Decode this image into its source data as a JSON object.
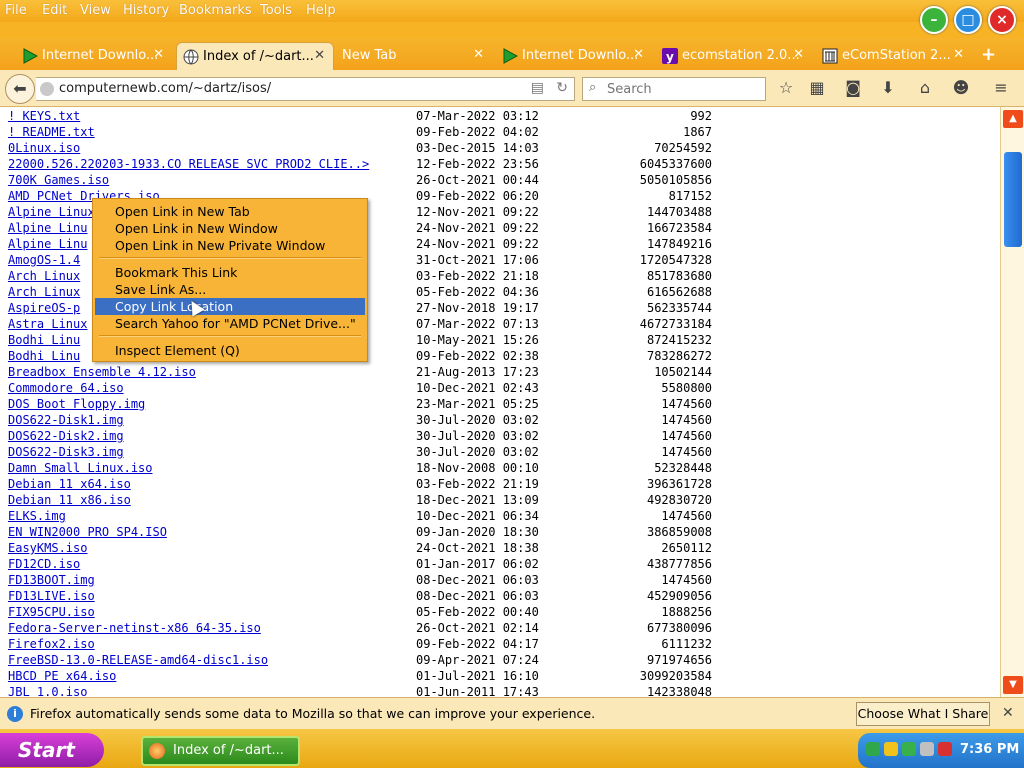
{
  "menus": [
    "File",
    "Edit",
    "View",
    "History",
    "Bookmarks",
    "Tools",
    "Help"
  ],
  "tabs": [
    {
      "label": "Internet Downlo...",
      "icon": "play-icon"
    },
    {
      "label": "Index of /~dart...",
      "icon": "globe-icon",
      "active": true
    },
    {
      "label": "New Tab",
      "icon": ""
    },
    {
      "label": "Internet Downlo...",
      "icon": "play-icon"
    },
    {
      "label": "ecomstation 2.0...",
      "icon": "yahoo-icon"
    },
    {
      "label": "eComStation 2...",
      "icon": "archive-icon"
    }
  ],
  "nav": {
    "url": "computernewb.com/~dartz/isos/",
    "search_placeholder": "Search"
  },
  "files": [
    {
      "name": "! KEYS.txt",
      "date": "07-Mar-2022 03:12",
      "size": "992"
    },
    {
      "name": "! README.txt",
      "date": "09-Feb-2022 04:02",
      "size": "1867"
    },
    {
      "name": "0Linux.iso",
      "date": "03-Dec-2015 14:03",
      "size": "70254592"
    },
    {
      "name": "22000.526.220203-1933.CO RELEASE SVC PROD2 CLIE..>",
      "date": "12-Feb-2022 23:56",
      "size": "6045337600"
    },
    {
      "name": "700K Games.iso",
      "date": "26-Oct-2021 00:44",
      "size": "5050105856"
    },
    {
      "name": "AMD PCNet Drivers.iso",
      "date": "09-Feb-2022 06:20",
      "size": "817152"
    },
    {
      "name": "Alpine Linux",
      "date": "12-Nov-2021 09:22",
      "size": "144703488"
    },
    {
      "name": "Alpine Linu",
      "date": "24-Nov-2021 09:22",
      "size": "166723584"
    },
    {
      "name": "Alpine Linu",
      "date": "24-Nov-2021 09:22",
      "size": "147849216"
    },
    {
      "name": "AmogOS-1.4",
      "date": "31-Oct-2021 17:06",
      "size": "1720547328"
    },
    {
      "name": "Arch Linux",
      "date": "03-Feb-2022 21:18",
      "size": "851783680"
    },
    {
      "name": "Arch Linux",
      "date": "05-Feb-2022 04:36",
      "size": "616562688"
    },
    {
      "name": "AspireOS-p",
      "date": "27-Nov-2018 19:17",
      "size": "562335744"
    },
    {
      "name": "Astra Linux",
      "date": "07-Mar-2022 07:13",
      "size": "4672733184"
    },
    {
      "name": "Bodhi Linu",
      "date": "10-May-2021 15:26",
      "size": "872415232"
    },
    {
      "name": "Bodhi Linu",
      "date": "09-Feb-2022 02:38",
      "size": "783286272"
    },
    {
      "name": "Breadbox Ensemble 4.12.iso",
      "date": "21-Aug-2013 17:23",
      "size": "10502144"
    },
    {
      "name": "Commodore 64.iso",
      "date": "10-Dec-2021 02:43",
      "size": "5580800"
    },
    {
      "name": "DOS Boot Floppy.img",
      "date": "23-Mar-2021 05:25",
      "size": "1474560"
    },
    {
      "name": "DOS622-Disk1.img",
      "date": "30-Jul-2020 03:02",
      "size": "1474560"
    },
    {
      "name": "DOS622-Disk2.img",
      "date": "30-Jul-2020 03:02",
      "size": "1474560"
    },
    {
      "name": "DOS622-Disk3.img",
      "date": "30-Jul-2020 03:02",
      "size": "1474560"
    },
    {
      "name": "Damn Small Linux.iso",
      "date": "18-Nov-2008 00:10",
      "size": "52328448"
    },
    {
      "name": "Debian 11 x64.iso",
      "date": "03-Feb-2022 21:19",
      "size": "396361728"
    },
    {
      "name": "Debian 11 x86.iso",
      "date": "18-Dec-2021 13:09",
      "size": "492830720"
    },
    {
      "name": "ELKS.img",
      "date": "10-Dec-2021 06:34",
      "size": "1474560"
    },
    {
      "name": "EN WIN2000 PRO SP4.ISO",
      "date": "09-Jan-2020 18:30",
      "size": "386859008"
    },
    {
      "name": "EasyKMS.iso",
      "date": "24-Oct-2021 18:38",
      "size": "2650112"
    },
    {
      "name": "FD12CD.iso",
      "date": "01-Jan-2017 06:02",
      "size": "438777856"
    },
    {
      "name": "FD13BOOT.img",
      "date": "08-Dec-2021 06:03",
      "size": "1474560"
    },
    {
      "name": "FD13LIVE.iso",
      "date": "08-Dec-2021 06:03",
      "size": "452909056"
    },
    {
      "name": "FIX95CPU.iso",
      "date": "05-Feb-2022 00:40",
      "size": "1888256"
    },
    {
      "name": "Fedora-Server-netinst-x86 64-35.iso",
      "date": "26-Oct-2021 02:14",
      "size": "677380096"
    },
    {
      "name": "Firefox2.iso",
      "date": "09-Feb-2022 04:17",
      "size": "6111232"
    },
    {
      "name": "FreeBSD-13.0-RELEASE-amd64-disc1.iso",
      "date": "09-Apr-2021 07:24",
      "size": "971974656"
    },
    {
      "name": "HBCD PE x64.iso",
      "date": "01-Jul-2021 16:10",
      "size": "3099203584"
    },
    {
      "name": "JBL 1.0.iso",
      "date": "01-Jun-2011 17:43",
      "size": "142338048"
    }
  ],
  "context_menu": {
    "groups": [
      [
        "Open Link in New Tab",
        "Open Link in New Window",
        "Open Link in New Private Window"
      ],
      [
        "Bookmark This Link",
        "Save Link As...",
        "Copy Link Location",
        "Search Yahoo for \"AMD PCNet Drive...\""
      ],
      [
        "Inspect Element (Q)"
      ]
    ],
    "highlighted": "Copy Link Location"
  },
  "notification": {
    "text": "Firefox automatically sends some data to Mozilla so that we can improve your experience.",
    "button": "Choose What I Share"
  },
  "taskbar": {
    "start": "Start",
    "window": "Index of /~dart...",
    "clock": "7:36 PM"
  },
  "colors": {
    "theme": "#f7b324",
    "link": "#0000cc",
    "highlight": "#3a6fc4",
    "scrollbar": "#f04b1a"
  }
}
